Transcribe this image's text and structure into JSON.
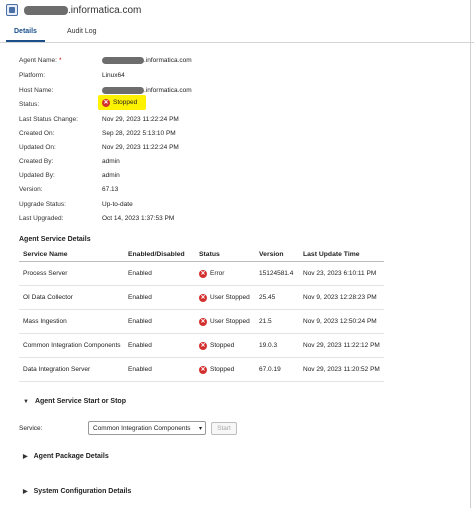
{
  "window": {
    "title_suffix": ".informatica.com"
  },
  "tabs": [
    {
      "label": "Details",
      "active": true
    },
    {
      "label": "Audit Log",
      "active": false
    }
  ],
  "fields": {
    "agent_name": {
      "label": "Agent Name:",
      "required_mark": "*",
      "value_suffix": ".informatica.com"
    },
    "platform": {
      "label": "Platform:",
      "value": "Linux64"
    },
    "host_name": {
      "label": "Host Name:",
      "value_suffix": ".informatica.com"
    },
    "status": {
      "label": "Status:",
      "value": "Stopped"
    },
    "last_status_change": {
      "label": "Last Status Change:",
      "value": "Nov 29, 2023 11:22:24 PM"
    },
    "created_on": {
      "label": "Created On:",
      "value": "Sep 28, 2022 5:13:10 PM"
    },
    "updated_on": {
      "label": "Updated On:",
      "value": "Nov 29, 2023 11:22:24 PM"
    },
    "created_by": {
      "label": "Created By:",
      "value": "admin"
    },
    "updated_by": {
      "label": "Updated By:",
      "value": "admin"
    },
    "version": {
      "label": "Version:",
      "value": "67.13"
    },
    "upgrade_status": {
      "label": "Upgrade Status:",
      "value": "Up-to-date"
    },
    "last_upgraded": {
      "label": "Last Upgraded:",
      "value": "Oct 14, 2023 1:37:53 PM"
    }
  },
  "services": {
    "title": "Agent Service Details",
    "columns": [
      "Service Name",
      "Enabled/Disabled",
      "Status",
      "Version",
      "Last Update Time"
    ],
    "rows": [
      {
        "name": "Process Server",
        "enabled": "Enabled",
        "status": "Error",
        "version": "15124581.4",
        "updated": "Nov 23, 2023 6:10:11 PM"
      },
      {
        "name": "OI Data Collector",
        "enabled": "Enabled",
        "status": "User Stopped",
        "version": "25.45",
        "updated": "Nov 9, 2023 12:28:23 PM"
      },
      {
        "name": "Mass Ingestion",
        "enabled": "Enabled",
        "status": "User Stopped",
        "version": "21.5",
        "updated": "Nov 9, 2023 12:50:24 PM"
      },
      {
        "name": "Common Integration Components",
        "enabled": "Enabled",
        "status": "Stopped",
        "version": "19.0.3",
        "updated": "Nov 29, 2023 11:22:12 PM"
      },
      {
        "name": "Data Integration Server",
        "enabled": "Enabled",
        "status": "Stopped",
        "version": "67.0.19",
        "updated": "Nov 29, 2023 11:20:52 PM"
      }
    ]
  },
  "start_stop": {
    "title": "Agent Service Start or Stop",
    "service_label": "Service:",
    "selected_service": "Common Integration Components",
    "start_label": "Start"
  },
  "package_details": {
    "title": "Agent Package Details"
  },
  "system_config": {
    "title": "System Configuration Details"
  },
  "colors": {
    "status_highlight": "#fff200",
    "error_red": "#d32f2f",
    "tab_accent": "#1a4f8a"
  }
}
